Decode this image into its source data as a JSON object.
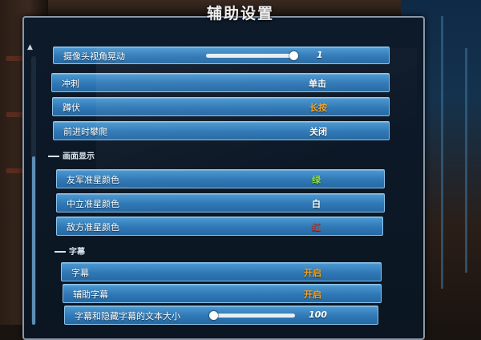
{
  "title": "辅助设置",
  "colors": {
    "value_default": "#ffffff",
    "value_orange": "#f6a21d",
    "value_green": "#8ee03a",
    "value_red": "#e53a2a"
  },
  "rows": [
    {
      "label": "摄像头视角晃动",
      "value": "1",
      "type": "slider",
      "level": 1.0
    },
    {
      "label": "冲刺",
      "value": "单击",
      "type": "option"
    },
    {
      "label": "蹲伏",
      "value": "长按",
      "type": "option",
      "value_color": "orange"
    },
    {
      "label": "前进时攀爬",
      "value": "关闭",
      "type": "option"
    }
  ],
  "sections": [
    {
      "title": "画面显示",
      "rows": [
        {
          "label": "友军准星颜色",
          "value": "绿",
          "value_color": "green"
        },
        {
          "label": "中立准星颜色",
          "value": "白"
        },
        {
          "label": "敌方准星颜色",
          "value": "红",
          "value_color": "red"
        }
      ]
    },
    {
      "title": "字幕",
      "rows": [
        {
          "label": "字幕",
          "value": "开启",
          "value_color": "orange"
        },
        {
          "label": "辅助字幕",
          "value": "开启",
          "value_color": "orange"
        },
        {
          "label": "字幕和隐藏字幕的文本大小",
          "value": "100",
          "type": "slider",
          "level": 0.0
        }
      ]
    }
  ],
  "icons": {
    "scroll_up": "up-arrow-icon"
  }
}
